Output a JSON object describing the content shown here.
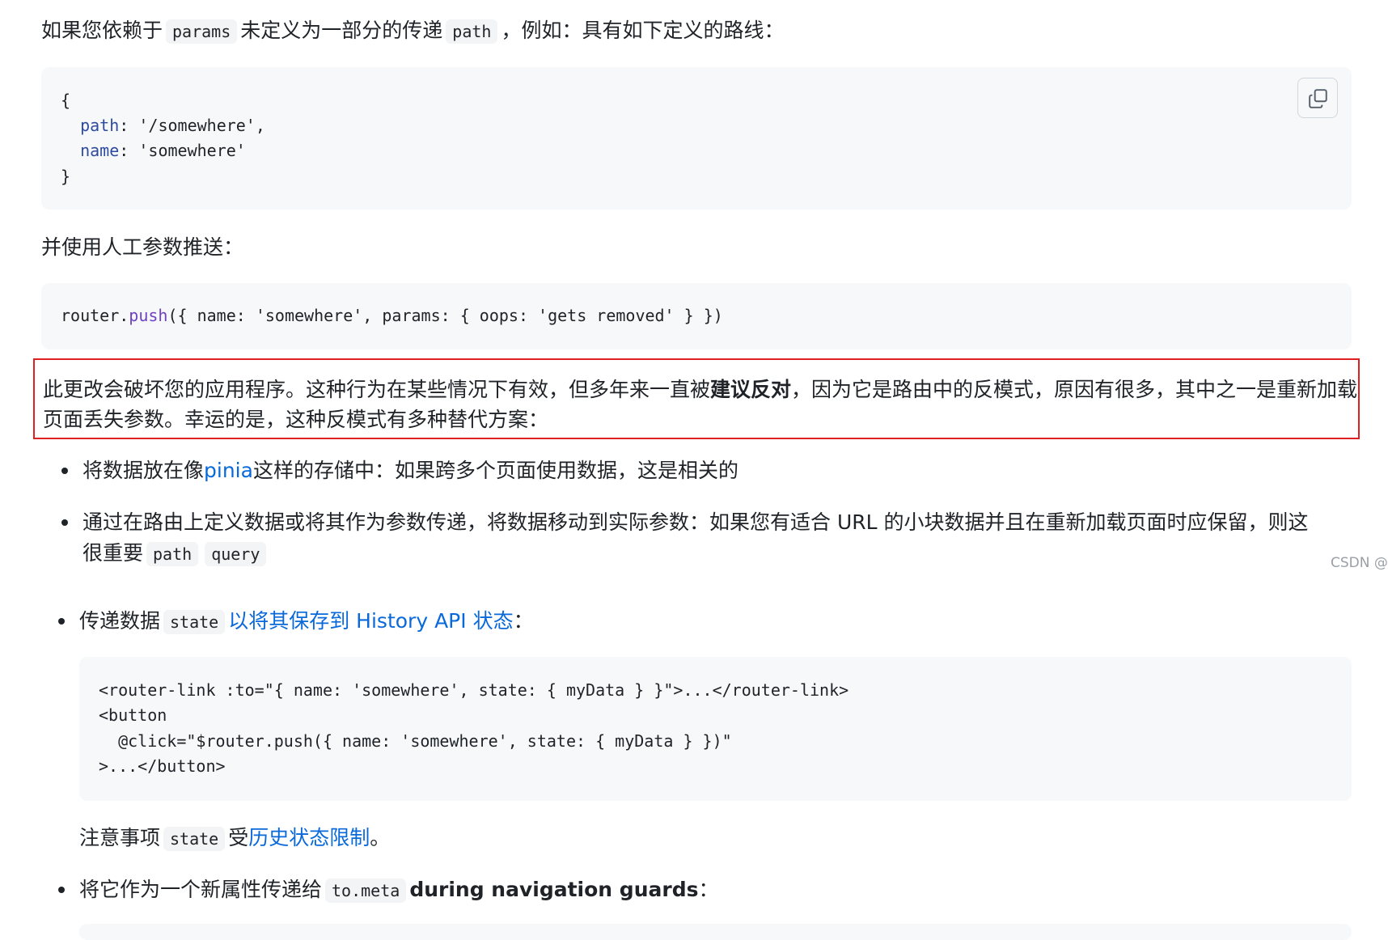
{
  "intro": {
    "part1": "如果您依赖于",
    "code1": "params",
    "part2": "未定义为一部分的传递",
    "code2": "path",
    "part3": "，例如：具有如下定义的路线："
  },
  "code_block_1": {
    "lines": [
      "{",
      "  path: '/somewhere',",
      "  name: 'somewhere'",
      "}"
    ],
    "keys": [
      "path",
      "name"
    ],
    "values": [
      "'/somewhere',",
      "'somewhere'"
    ]
  },
  "copy_button_icon": "copy-icon",
  "para2": "并使用人工参数推送：",
  "code_block_2": {
    "obj": "router",
    "method": "push",
    "rest": "({ name: 'somewhere', params: { oops: 'gets removed' } })"
  },
  "warning": {
    "part1": "此更改会破坏您的应用程序。这种行为在某些情况下有效，但多年来一直被",
    "bold": "建议反对",
    "part2": "，因为它是路由中的反模式，原因有很多，其中之一是重新加载页面丢失参数。幸运的是，这种反模式有多种替代方案："
  },
  "bullets": [
    {
      "before": "将数据放在像",
      "link": "pinia",
      "after": "这样的存储中：如果跨多个页面使用数据，这是相关的"
    },
    {
      "line1": "通过在路由上定义数据或将其作为参数传递，将数据移动到实际参数：如果您有适合 URL 的小块数据并且在重新加载页面时应保留，则这",
      "line2": "很重要",
      "code1": "path",
      "code2": "query"
    },
    {
      "before": "传递数据",
      "code": "state",
      "link": "以将其保存到 History API 状态",
      "after": "："
    }
  ],
  "watermark": "CSDN @",
  "code_block_3": {
    "lines": [
      "<router-link :to=\"{ name: 'somewhere', state: { myData } }\">...</router-link>",
      "<button",
      "  @click=\"$router.push({ name: 'somewhere', state: { myData } })\"",
      ">...</button>"
    ]
  },
  "note": {
    "before": "注意事项",
    "code": "state",
    "mid": "受",
    "link": "历史状态限制",
    "after": "。"
  },
  "bullet4": {
    "before": "将它作为一个新属性传递给",
    "code": "to.meta",
    "bold": "during navigation guards",
    "after": "："
  }
}
